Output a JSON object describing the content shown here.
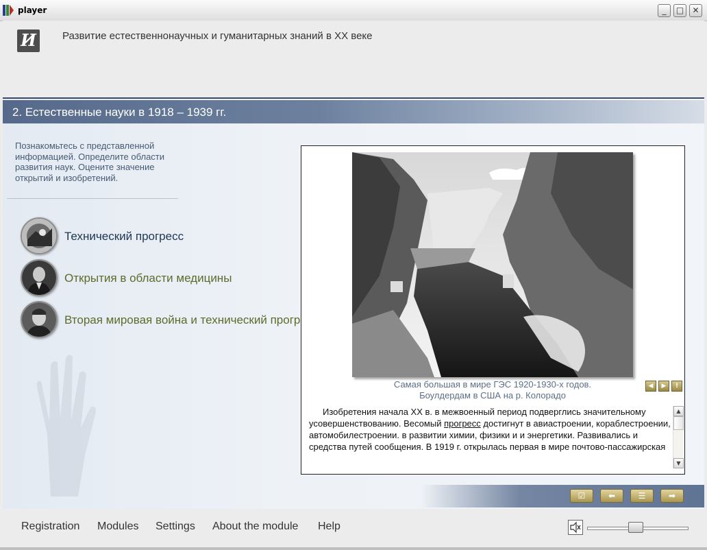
{
  "window": {
    "title": "player",
    "minimize_glyph": "_",
    "maximize_glyph": "□",
    "close_glyph": "✕"
  },
  "header": {
    "logo_text": "И",
    "course_title": "Развитие естественнонаучных и гуманитарных знаний в XX веке"
  },
  "section": {
    "title": "2. Естественные науки в 1918 – 1939 гг."
  },
  "intro": {
    "text": "Познакомьтесь с представленной информацией. Определите области развития наук. Оцените значение открытий и изобретений."
  },
  "topics": [
    {
      "label": "Технический прогресс",
      "color": "#1f3552"
    },
    {
      "label": "Открытия в области медицины",
      "color": "#5c6b2a"
    },
    {
      "label": "Вторая мировая война и технический прогресс",
      "color": "#5c6b2a"
    }
  ],
  "content": {
    "caption_line1": "Самая большая в мире ГЭС 1920-1930-х годов.",
    "caption_line2": "Боулдердам в США на р. Колорадо",
    "body_before": "Изобретения начала XX в. в межвоенный период подверглись значительному усовершенствованию. Весомый ",
    "body_link": "прогресс",
    "body_after": " достигнут в авиастроении, кораблестроении, автомобилестроении. в развитии химии, физики и и энергетики. Развивались и средства путей сообщения. В 1919 г. открылась первая в мире почтово-пассажирская"
  },
  "colors": {
    "accent": "#56698a",
    "button_gold": "#c9b872",
    "caption": "#5b6f88"
  },
  "footer": {
    "menu": [
      "Registration",
      "Modules",
      "Settings",
      "About the module",
      "Help"
    ],
    "volume_fraction": 0.48
  },
  "icons": {
    "mute": "speaker-mute-icon",
    "prev": "arrow-left-icon",
    "next": "arrow-right-icon",
    "info": "info-icon",
    "check": "check-icon",
    "back": "back-arrow-icon",
    "list": "list-icon",
    "forward": "forward-arrow-icon"
  }
}
